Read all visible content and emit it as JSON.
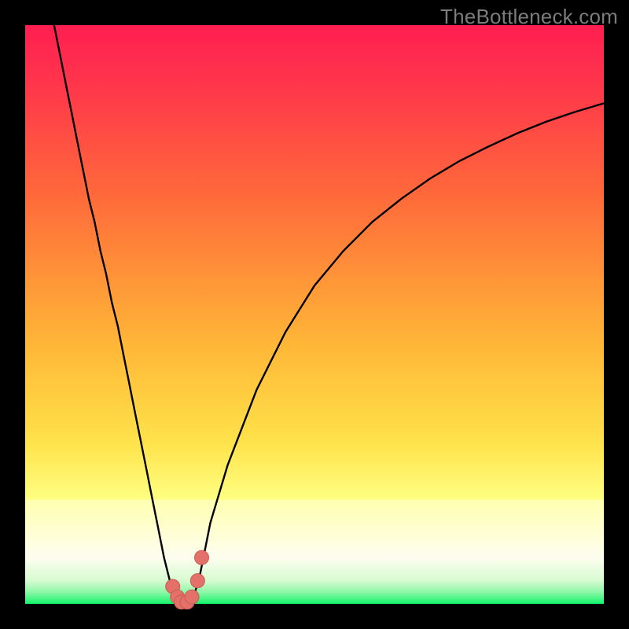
{
  "watermark": "TheBottleneck.com",
  "colors": {
    "frame": "#000000",
    "gradient_top": "#ff1e51",
    "gradient_mid1": "#ff6b3a",
    "gradient_mid2": "#ffc537",
    "gradient_band_top": "#ffff9a",
    "gradient_band_bottom": "#fdfde0",
    "gradient_bottom": "#12f56c",
    "curve": "#000000",
    "marker_fill": "#e37169",
    "marker_stroke": "#ca5a53"
  },
  "chart_data": {
    "type": "line",
    "title": "",
    "xlabel": "",
    "ylabel": "",
    "xlim": [
      0,
      100
    ],
    "ylim": [
      0,
      100
    ],
    "x": [
      5,
      6,
      7,
      8,
      9,
      10,
      11,
      12,
      13,
      14,
      15,
      16,
      17,
      18,
      19,
      20,
      21,
      22,
      23,
      24,
      25,
      26,
      27,
      28,
      29,
      30,
      31,
      32,
      35,
      40,
      45,
      50,
      55,
      60,
      65,
      70,
      75,
      80,
      85,
      90,
      95,
      100
    ],
    "values": [
      100,
      95,
      90,
      85,
      80,
      75,
      70,
      66,
      61,
      57,
      52,
      48,
      43,
      38,
      33,
      28,
      23,
      18,
      13,
      8,
      4,
      1,
      0,
      0,
      1,
      4,
      9,
      14,
      24,
      37,
      47,
      55,
      61,
      66,
      70,
      73.5,
      76.5,
      79,
      81.3,
      83.3,
      85,
      86.5
    ],
    "valley_x_range": [
      26,
      29
    ],
    "markers": [
      {
        "x": 25.5,
        "y": 3.0
      },
      {
        "x": 26.3,
        "y": 1.2
      },
      {
        "x": 27.0,
        "y": 0.3
      },
      {
        "x": 28.0,
        "y": 0.3
      },
      {
        "x": 28.8,
        "y": 1.2
      },
      {
        "x": 29.8,
        "y": 4.0
      },
      {
        "x": 30.5,
        "y": 8.0
      }
    ]
  }
}
